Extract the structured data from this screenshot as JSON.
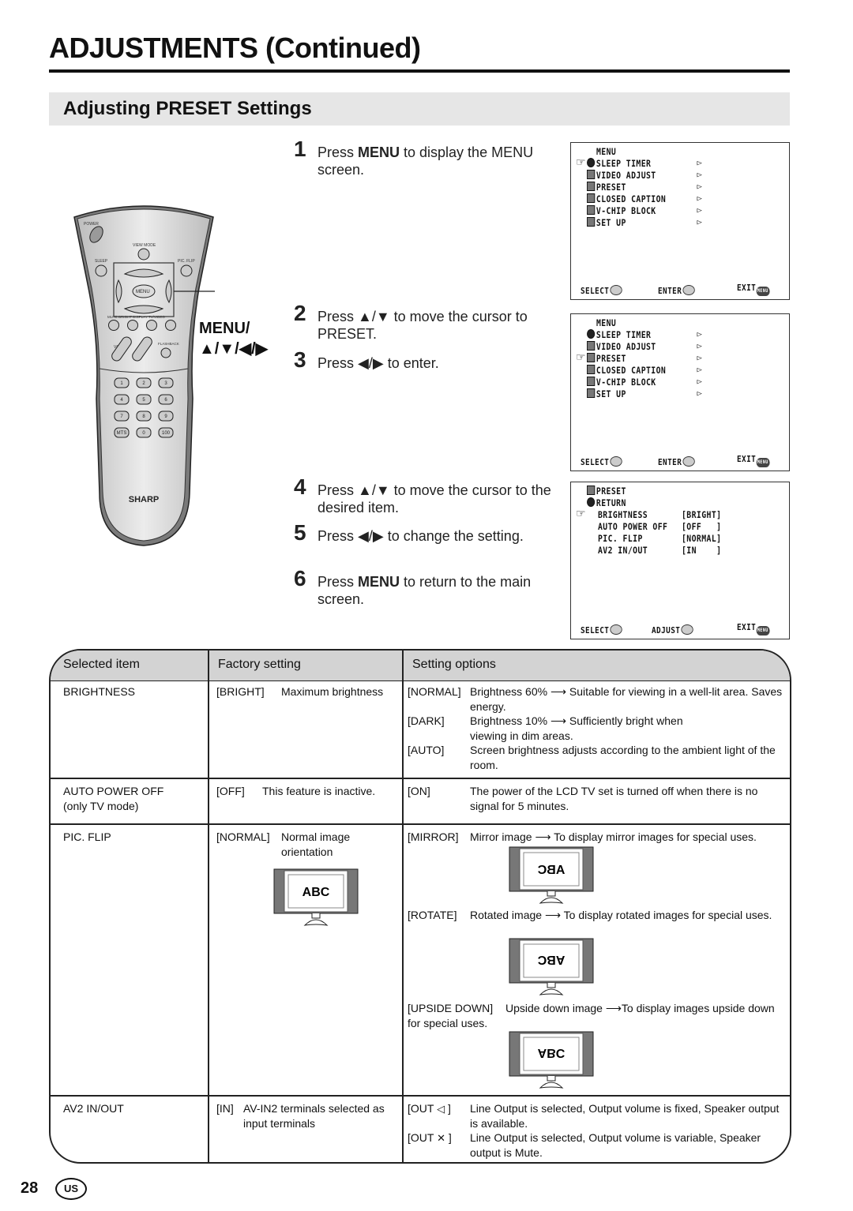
{
  "header": {
    "title": "ADJUSTMENTS (Continued)",
    "section_title": "Adjusting PRESET Settings"
  },
  "remote": {
    "brand": "SHARP",
    "callout_line1": "MENU/",
    "callout_line2": "▲/▼/◀/▶",
    "labels": {
      "power": "POWER",
      "view_mode": "VIEW MODE",
      "sleep": "SLEEP",
      "pic_flip": "PIC. FLIP",
      "menu": "MENU",
      "mute": "MUTE",
      "bright": "BRIGHT",
      "display": "DISPLAY",
      "tv_video": "TV/VIDEO",
      "vol": "VOL",
      "ch": "CH",
      "flashback": "FLASHBACK"
    },
    "keypad": [
      "1",
      "2",
      "3",
      "4",
      "5",
      "6",
      "7",
      "8",
      "9",
      "MTS",
      "0",
      "100"
    ]
  },
  "steps": [
    {
      "num": "1",
      "pre": "Press ",
      "bold": "MENU",
      "post": " to display the MENU screen."
    },
    {
      "num": "2",
      "pre": "Press ▲/▼ to move the cursor to PRESET.",
      "bold": "",
      "post": ""
    },
    {
      "num": "3",
      "pre": "Press ◀/▶ to enter.",
      "bold": "",
      "post": ""
    },
    {
      "num": "4",
      "pre": "Press ▲/▼ to move the cursor to the desired item.",
      "bold": "",
      "post": ""
    },
    {
      "num": "5",
      "pre": "Press ◀/▶ to change the setting.",
      "bold": "",
      "post": ""
    },
    {
      "num": "6",
      "pre": "Press ",
      "bold": "MENU",
      "post": " to return to the main screen."
    }
  ],
  "osd_menu": {
    "title": "MENU",
    "items": [
      "SLEEP TIMER",
      "VIDEO ADJUST",
      "PRESET",
      "CLOSED CAPTION",
      "V-CHIP BLOCK",
      "SET UP"
    ],
    "footer": {
      "select": "SELECT",
      "enter": "ENTER",
      "exit": "EXIT",
      "menu_btn": "MENU"
    },
    "screen1_cursor": "SLEEP TIMER",
    "screen2_cursor": "PRESET"
  },
  "osd_preset": {
    "title": "PRESET",
    "return": "RETURN",
    "items": [
      {
        "label": "BRIGHTNESS",
        "value": "[BRIGHT]"
      },
      {
        "label": "AUTO POWER OFF",
        "value": "[OFF   ]"
      },
      {
        "label": "PIC. FLIP",
        "value": "[NORMAL]"
      },
      {
        "label": "AV2 IN/OUT",
        "value": "[IN    ]"
      }
    ],
    "cursor": "BRIGHTNESS",
    "footer": {
      "select": "SELECT",
      "adjust": "ADJUST",
      "exit": "EXIT",
      "menu_btn": "MENU"
    }
  },
  "table": {
    "headers": [
      "Selected item",
      "Factory setting",
      "Setting options"
    ],
    "rows": [
      {
        "item": "BRIGHTNESS",
        "item_note": "",
        "factory_key": "[BRIGHT]",
        "factory_desc": "Maximum brightness",
        "options": [
          {
            "key": "[NORMAL]",
            "desc": "Brightness 60% ⟶ Suitable for viewing in a well-lit area. Saves energy."
          },
          {
            "key": "[DARK]",
            "desc": "Brightness 10% ⟶ Sufficiently bright when viewing in dim areas."
          },
          {
            "key": "[AUTO]",
            "desc": "Screen brightness adjusts according to the ambient light of the room."
          }
        ]
      },
      {
        "item": "AUTO POWER OFF",
        "item_note": "(only TV mode)",
        "factory_key": "[OFF]",
        "factory_desc": "This feature is inactive.",
        "options": [
          {
            "key": "[ON]",
            "desc": "The power of the LCD TV set is turned off when there is no signal for 5 minutes."
          }
        ]
      },
      {
        "item": "PIC. FLIP",
        "item_note": "",
        "factory_key": "[NORMAL]",
        "factory_desc": "Normal image orientation",
        "factory_image_text": "ABC",
        "options": [
          {
            "key": "[MIRROR]",
            "desc": "Mirror image ⟶ To display mirror images for special uses.",
            "image_text": "ABC"
          },
          {
            "key": "[ROTATE]",
            "desc": "Rotated image ⟶ To display rotated images for special uses.",
            "image_text": "ABC"
          },
          {
            "key": "[UPSIDE DOWN]",
            "desc": "Upside down image ⟶To display images upside down for special uses.",
            "image_text": "ABC"
          }
        ]
      },
      {
        "item": "AV2 IN/OUT",
        "item_note": "",
        "factory_key": "[IN]",
        "factory_desc": "AV-IN2 terminals selected as input terminals",
        "options": [
          {
            "key": "[OUT",
            "icon": "speaker-icon",
            "key_end": "]",
            "desc": "Line Output is selected, Output volume is fixed, Speaker output is available."
          },
          {
            "key": "[OUT",
            "icon": "speaker-mute-icon",
            "key_end": "]",
            "desc": "Line Output is selected, Output volume is variable, Speaker output is Mute."
          }
        ]
      }
    ]
  },
  "footer": {
    "page_number": "28",
    "region": "US"
  }
}
